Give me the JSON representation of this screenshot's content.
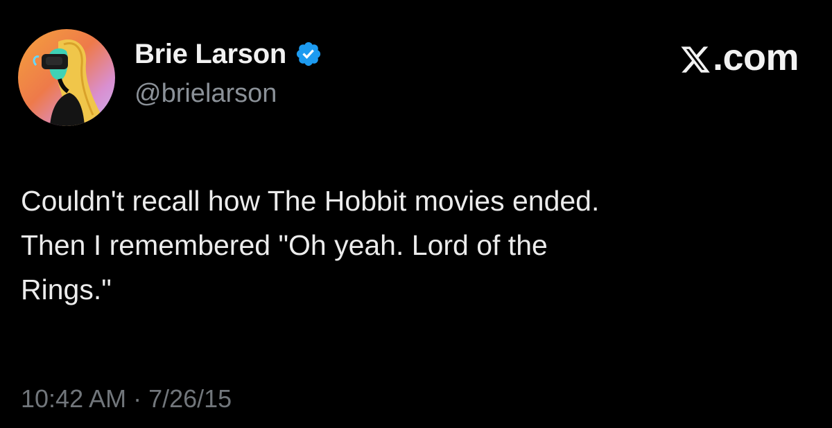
{
  "tweet": {
    "author": {
      "display_name": "Brie Larson",
      "handle": "@brielarson",
      "verified": true
    },
    "site_label": ".com",
    "text": "Couldn't recall how The Hobbit movies ended.\nThen I remembered \"Oh yeah. Lord of the\nRings.\"",
    "timestamp": "10:42 AM · 7/26/15"
  },
  "icons": {
    "verified_badge": "verified-badge-icon",
    "x_logo": "x-logo-icon",
    "avatar": "illustrated-portrait"
  },
  "colors": {
    "background": "#000000",
    "text_primary": "#ececec",
    "text_secondary": "#8b9198",
    "timestamp": "#71767b",
    "verified_blue": "#1d9bf0"
  }
}
